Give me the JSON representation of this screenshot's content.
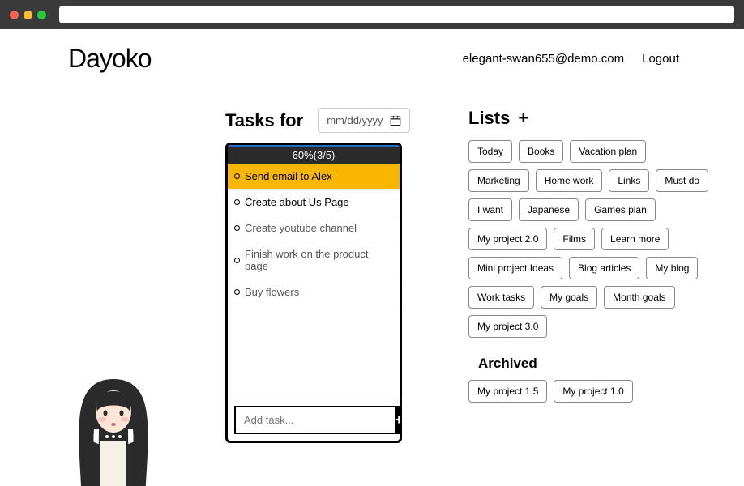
{
  "app": {
    "name": "Dayoko"
  },
  "header": {
    "user_email": "elegant-swan655@demo.com",
    "logout": "Logout"
  },
  "tasks": {
    "title": "Tasks for",
    "date_placeholder": "mm/dd/yyyy",
    "progress_text": "60%(3/5)",
    "items": [
      {
        "text": "Send email to Alex",
        "done": false,
        "selected": true
      },
      {
        "text": "Create about Us Page",
        "done": false,
        "selected": false
      },
      {
        "text": "Create youtube channel",
        "done": true,
        "selected": false
      },
      {
        "text": "Finish work on the product page",
        "done": true,
        "selected": false
      },
      {
        "text": "Buy flowers",
        "done": true,
        "selected": false
      }
    ],
    "add_placeholder": "Add task..."
  },
  "lists": {
    "title": "Lists",
    "add_label": "+",
    "items": [
      "Today",
      "Books",
      "Vacation plan",
      "Marketing",
      "Home work",
      "Links",
      "Must do",
      "I want",
      "Japanese",
      "Games plan",
      "My project 2.0",
      "Films",
      "Learn more",
      "Mini project Ideas",
      "Blog articles",
      "My blog",
      "Work tasks",
      "My goals",
      "Month goals",
      "My project 3.0"
    ],
    "archived_title": "Archived",
    "archived": [
      "My project 1.5",
      "My project 1.0"
    ]
  }
}
